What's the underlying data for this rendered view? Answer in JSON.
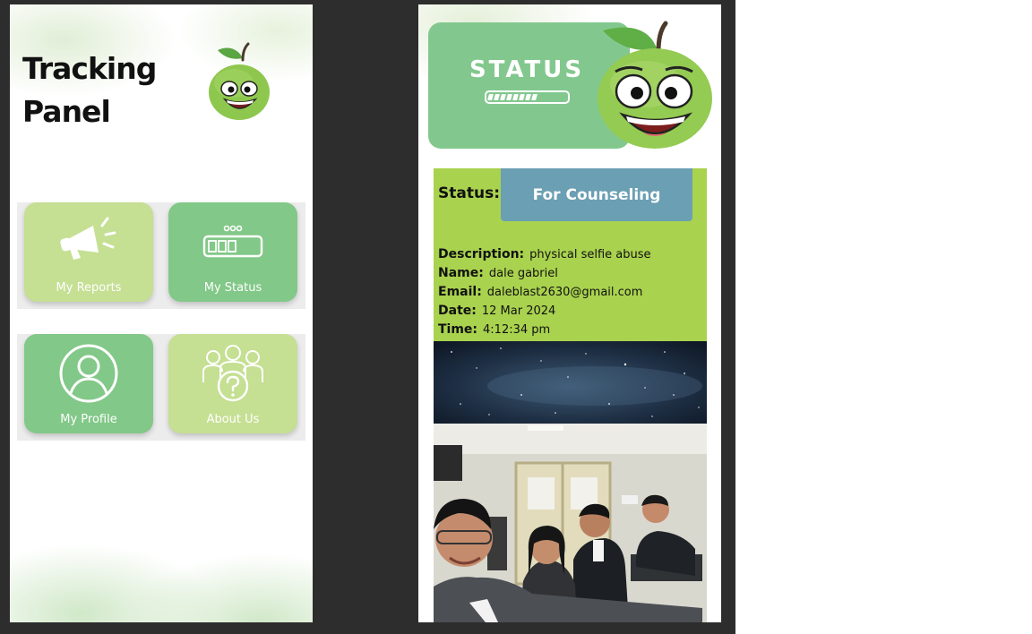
{
  "tracking_panel": {
    "title": "Tracking Panel",
    "tiles": [
      {
        "label": "My Reports",
        "icon": "megaphone-icon",
        "color": "#c5df93"
      },
      {
        "label": "My Status",
        "icon": "progress-bar-icon",
        "color": "#82c888"
      },
      {
        "label": "My Profile",
        "icon": "user-circle-icon",
        "color": "#82c888"
      },
      {
        "label": "About Us",
        "icon": "group-question-icon",
        "color": "#c5df93"
      }
    ]
  },
  "status_screen": {
    "banner_title": "STATUS",
    "status_label": "Status:",
    "status_value": "For Counseling",
    "details": [
      {
        "key": "Description:",
        "value": "physical selfie abuse"
      },
      {
        "key": "Name:",
        "value": "dale gabriel"
      },
      {
        "key": "Email:",
        "value": "daleblast2630@gmail.com"
      },
      {
        "key": "Date:",
        "value": "12 Mar 2024"
      },
      {
        "key": "Time:",
        "value": "4:12:34 pm"
      }
    ],
    "attachments": [
      "starry-space-image",
      "group-selfie-photo"
    ]
  },
  "colors": {
    "canvas": "#2d2d2d",
    "light_green": "#c5df93",
    "mid_green": "#82c888",
    "card_green": "#a9d24e",
    "status_blue": "#6b9fb3"
  }
}
